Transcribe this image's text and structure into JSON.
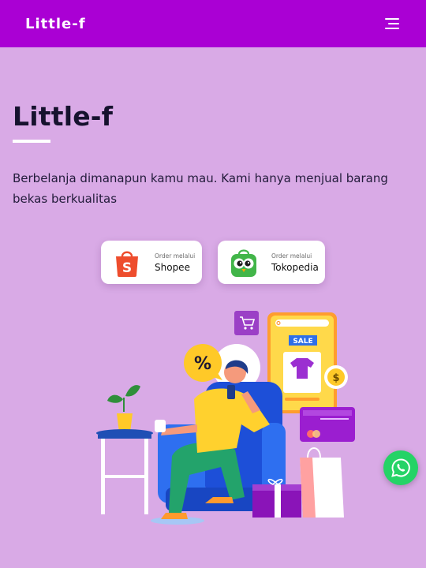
{
  "navbar": {
    "brand": "Little-f",
    "menu_icon": "hamburger-menu-icon"
  },
  "hero": {
    "title": "Little-f",
    "description": "Berbelanja dimanapun kamu mau. Kami hanya menjual barang bekas berkualitas"
  },
  "stores": [
    {
      "prefix": "Order melalui",
      "name": "Shopee",
      "icon": "shopee-bag-icon"
    },
    {
      "prefix": "Order melalui",
      "name": "Tokopedia",
      "icon": "tokopedia-owl-icon"
    }
  ],
  "illustration": {
    "sale_label": "SALE",
    "percent_symbol": "%",
    "dollar_symbol": "$"
  },
  "whatsapp": {
    "icon": "whatsapp-icon"
  },
  "colors": {
    "navbar": "#aa00d4",
    "background": "#d9aae6",
    "whatsapp": "#25d366"
  }
}
